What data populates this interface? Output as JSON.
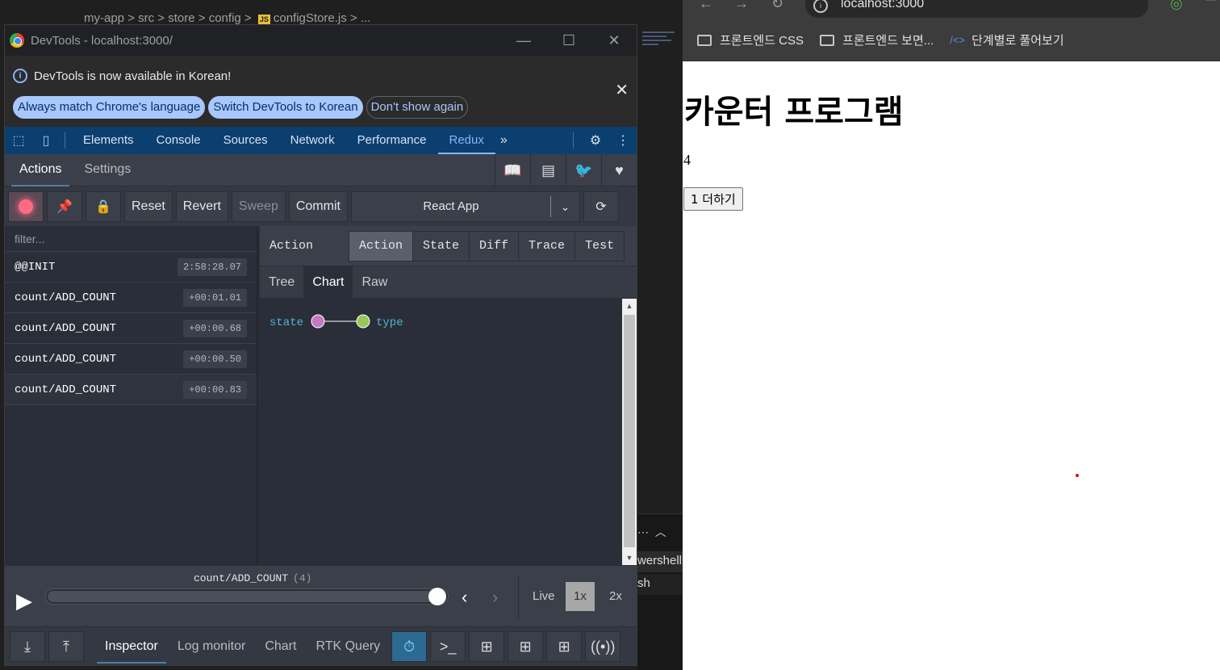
{
  "vscode": {
    "breadcrumb": [
      "my-app",
      "src",
      "store",
      "config",
      "configStore.js",
      "..."
    ],
    "terminal_rows": [
      "wershell",
      "sh"
    ]
  },
  "devtools": {
    "window_title": "DevTools - localhost:3000/",
    "infobar": {
      "message": "DevTools is now available in Korean!",
      "btn_match": "Always match Chrome's language",
      "btn_switch": "Switch DevTools to Korean",
      "btn_dont_show": "Don't show again"
    },
    "tabs": [
      "Elements",
      "Console",
      "Sources",
      "Network",
      "Performance",
      "Redux"
    ],
    "active_tab": "Redux"
  },
  "redux": {
    "top_tabs": [
      "Actions",
      "Settings"
    ],
    "toolbar": {
      "reset": "Reset",
      "revert": "Revert",
      "sweep": "Sweep",
      "commit": "Commit",
      "instance": "React App"
    },
    "filter_placeholder": "filter...",
    "actions": [
      {
        "name": "@@INIT",
        "time": "2:58:28.07"
      },
      {
        "name": "count/ADD_COUNT",
        "time": "+00:01.01"
      },
      {
        "name": "count/ADD_COUNT",
        "time": "+00:00.68"
      },
      {
        "name": "count/ADD_COUNT",
        "time": "+00:00.50"
      },
      {
        "name": "count/ADD_COUNT",
        "time": "+00:00.83"
      }
    ],
    "detail": {
      "title": "Action",
      "segments": [
        "Action",
        "State",
        "Diff",
        "Trace",
        "Test"
      ],
      "active_segment": "Action",
      "sub_tabs": [
        "Tree",
        "Chart",
        "Raw"
      ],
      "active_sub_tab": "Chart",
      "chart_nodes": [
        {
          "label": "state",
          "color": "#c678c0"
        },
        {
          "label": "type",
          "color": "#98c75a"
        }
      ]
    },
    "slider": {
      "action_label": "count/ADD_COUNT",
      "action_index": "(4)",
      "position_fraction": 1.0,
      "speeds": [
        "Live",
        "1x",
        "2x"
      ],
      "active_speed": "1x"
    },
    "bottom_tabs": [
      "Inspector",
      "Log monitor",
      "Chart",
      "RTK Query"
    ],
    "active_bottom_tab": "Inspector"
  },
  "browser": {
    "url": "localhost:3000",
    "bookmarks": [
      "프론트엔드 CSS",
      "프론트엔드 보면...",
      "단계별로 풀어보기"
    ],
    "page": {
      "heading": "카운터 프로그램",
      "count": "4",
      "button": "1 더하기"
    }
  },
  "colors": {
    "devtools_tab_bg": "#0b3f70",
    "redux_bg": "#2a2e38",
    "accent_blue": "#8ab4f8"
  }
}
